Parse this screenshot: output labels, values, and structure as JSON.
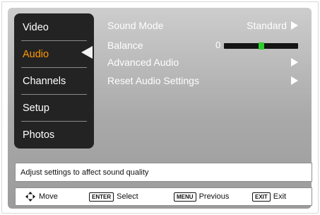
{
  "sidebar": {
    "items": [
      {
        "label": "Video"
      },
      {
        "label": "Audio",
        "active": true
      },
      {
        "label": "Channels"
      },
      {
        "label": "Setup"
      },
      {
        "label": "Photos"
      }
    ]
  },
  "settings": {
    "sound_mode": {
      "label": "Sound Mode",
      "value": "Standard"
    },
    "balance": {
      "label": "Balance",
      "value": "0",
      "level": 0.5
    },
    "advanced_audio": {
      "label": "Advanced Audio"
    },
    "reset_audio": {
      "label": "Reset Audio Settings"
    }
  },
  "help_text": "Adjust settings to affect sound quality",
  "footer": {
    "move": {
      "key_icon": "dpad-icon",
      "label": "Move"
    },
    "select": {
      "key": "ENTER",
      "label": "Select"
    },
    "previous": {
      "key": "MENU",
      "label": "Previous"
    },
    "exit": {
      "key": "EXIT",
      "label": "Exit"
    }
  },
  "colors": {
    "active": "#ff9a00",
    "slider_knob": "#2ecc2e"
  }
}
